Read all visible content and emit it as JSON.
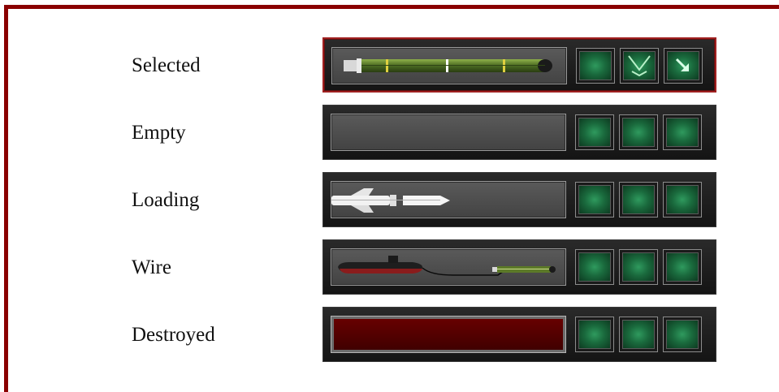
{
  "rows": [
    {
      "label": "Selected",
      "state": "selected"
    },
    {
      "label": "Empty",
      "state": "empty"
    },
    {
      "label": "Loading",
      "state": "loading"
    },
    {
      "label": "Wire",
      "state": "wire"
    },
    {
      "label": "Destroyed",
      "state": "destroyed"
    }
  ],
  "colors": {
    "frame": "#8a0000",
    "button_green": "#1a6a3d",
    "selected_border": "#a02020",
    "destroyed_fill": "#5a0000"
  },
  "icons": {
    "selected_button_2": "chevron-down-icon",
    "selected_button_3": "arrow-down-right-icon"
  }
}
